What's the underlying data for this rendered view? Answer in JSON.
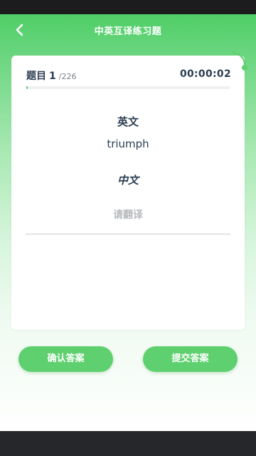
{
  "header": {
    "title": "中英互译练习题",
    "back_icon": "chevron-left-icon"
  },
  "question": {
    "label": "题目",
    "number": "1",
    "total": "/226",
    "timer": "00:00:02",
    "progress_fraction": 0.004
  },
  "content": {
    "english_label": "英文",
    "word": "triumph",
    "chinese_label": "中文",
    "answer_value": "",
    "answer_placeholder": "请翻译"
  },
  "buttons": {
    "confirm_label": "确认答案",
    "submit_label": "提交答案"
  },
  "colors": {
    "accent": "#5fd06f",
    "text_primary": "#2c3e52",
    "placeholder": "#b6b9bd"
  }
}
